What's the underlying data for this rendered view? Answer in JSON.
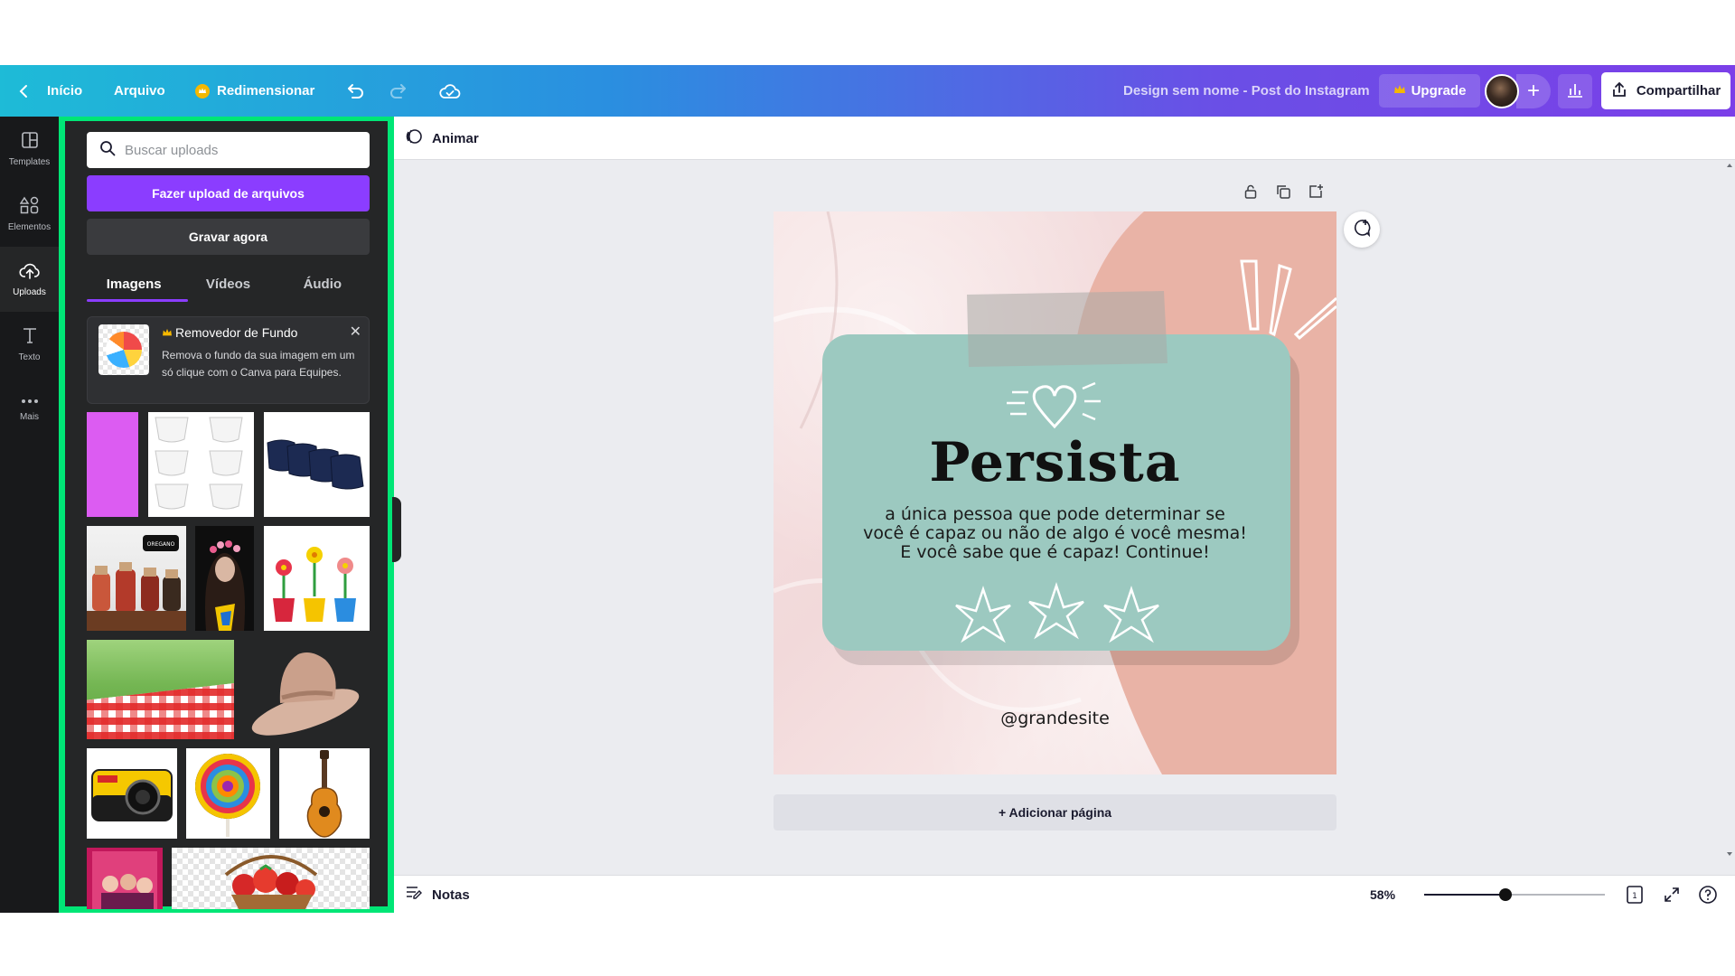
{
  "topbar": {
    "home_label": "Início",
    "file_label": "Arquivo",
    "resize_label": "Redimensionar",
    "doc_title": "Design sem nome - Post do Instagram",
    "upgrade_label": "Upgrade",
    "share_label": "Compartilhar",
    "accent_gold": "#f5b800"
  },
  "rail": {
    "items": [
      {
        "label": "Templates",
        "icon": "templates-icon"
      },
      {
        "label": "Elementos",
        "icon": "elements-icon"
      },
      {
        "label": "Uploads",
        "icon": "upload-cloud-icon"
      },
      {
        "label": "Texto",
        "icon": "text-icon"
      },
      {
        "label": "Mais",
        "icon": "more-icon"
      }
    ],
    "active": "Uploads"
  },
  "panel": {
    "search_placeholder": "Buscar uploads",
    "upload_button": "Fazer upload de arquivos",
    "record_button": "Gravar agora",
    "tabs": [
      "Imagens",
      "Vídeos",
      "Áudio"
    ],
    "active_tab": "Imagens",
    "promo": {
      "title": "Removedor de Fundo",
      "text": "Remova o fundo da sua imagem em um só clique com o Canva para Equipes."
    },
    "oregano_label": "OREGANO",
    "accent_purple": "#8b3dff",
    "highlight_border": "#00e676"
  },
  "canvas_toolbar": {
    "animate_label": "Animar"
  },
  "design": {
    "title": "Persista",
    "body_lines": [
      "a única pessoa que pode determinar se",
      "você é capaz ou não de algo é você mesma!",
      "E você sabe que é capaz! Continue!"
    ],
    "handle": "@grandesite",
    "card_color": "#9cc9c0",
    "arc_color": "#e9b3a6"
  },
  "add_page_label": "+ Adicionar página",
  "bottombar": {
    "notes_label": "Notas",
    "zoom_label": "58%",
    "zoom_fraction": 0.45,
    "page_count": "1"
  }
}
